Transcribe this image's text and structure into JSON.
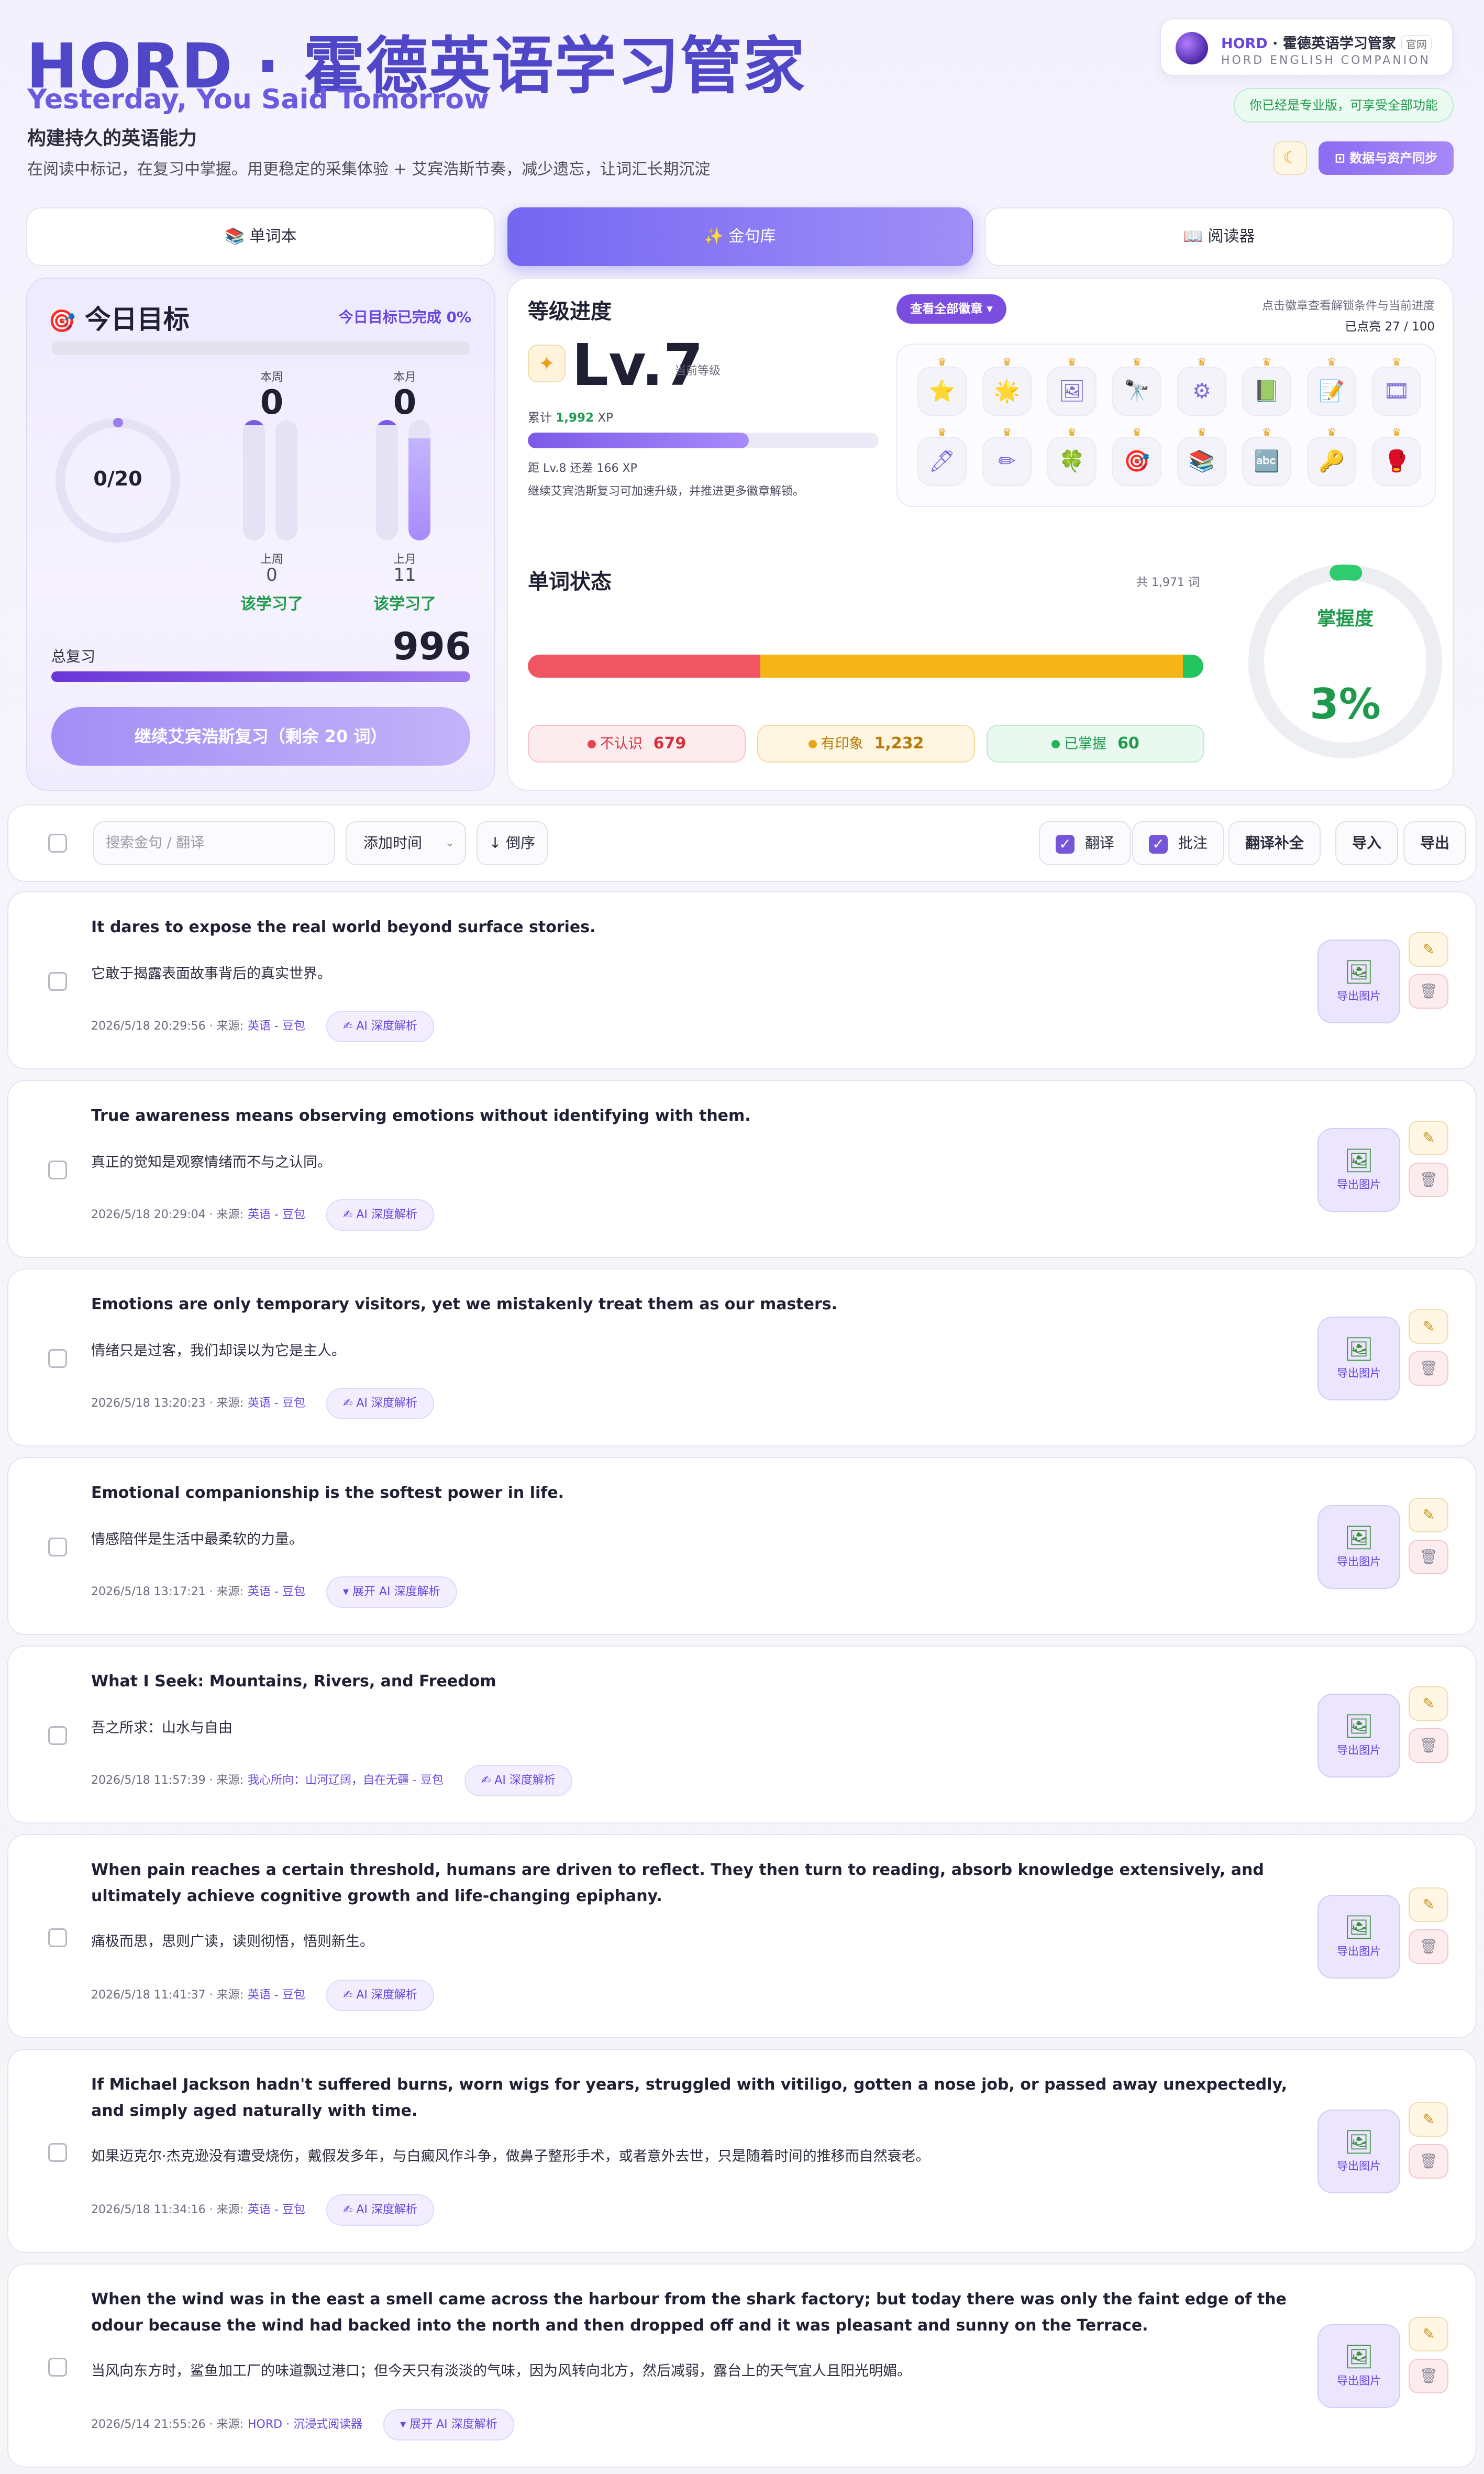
{
  "header": {
    "title": "HORD · 霍德英语学习管家",
    "subtitle": "Yesterday, You Said Tomorrow",
    "tagline": "构建持久的英语能力",
    "description": "在阅读中标记，在复习中掌握。用更稳定的采集体验 + 艾宾浩斯节奏，减少遗忘，让词汇长期沉淀"
  },
  "site": {
    "brand": "HORD",
    "name": " · 霍德英语学习管家",
    "official": "官网",
    "english": "HORD ENGLISH COMPANION"
  },
  "pro_badge": "你已经是专业版，可享受全部功能",
  "theme_icon": "moon-icon",
  "sync_button": "数据与资产同步",
  "tabs": [
    {
      "icon": "📚",
      "label": "单词本"
    },
    {
      "icon": "✨",
      "label": "金句库"
    },
    {
      "icon": "📖",
      "label": "阅读器"
    }
  ],
  "goal": {
    "title": "今日目标",
    "done_text": "今日目标已完成 0%",
    "progress_pct": 0,
    "ring_text": "0/20",
    "ring_fraction": 0,
    "week": {
      "label": "本周",
      "value": "0",
      "prev_label": "上周",
      "prev_value": "0",
      "prev_fraction": 0,
      "status": "该学习了"
    },
    "month": {
      "label": "本月",
      "value": "0",
      "prev_label": "上月",
      "prev_value": "11",
      "prev_fraction": 0.85,
      "status": "该学习了"
    },
    "total_label": "总复习",
    "total_value": "996",
    "review_button": "继续艾宾浩斯复习（剩余 20 词）"
  },
  "level": {
    "title": "等级进度",
    "badges_button": "查看全部徽章 ▾",
    "hint": "点击徽章查看解锁条件与当前进度",
    "lit_count": "已点亮 27 / 100",
    "star": "✦",
    "level": "Lv.7",
    "level_caption": "当前等级",
    "xp_prefix": "累计 ",
    "xp_value": "1,992",
    "xp_suffix": " XP",
    "xp_progress": 0.63,
    "next_text": "距 Lv.8 还差 166 XP",
    "tip": "继续艾宾浩斯复习可加速升级，并推进更多徽章解锁。",
    "badges": [
      "⭐",
      "🌟",
      "🖼",
      "🔭",
      "⚙",
      "📗",
      "📝",
      "🎞",
      "🖊",
      "✏",
      "🍀",
      "🎯",
      "📚",
      "🔤",
      "🔑",
      "🥊"
    ]
  },
  "words": {
    "title": "单词状态",
    "total_text": "共 1,971 词",
    "unknown": {
      "label": "不认识",
      "value": 679,
      "color": "#f05562"
    },
    "impression": {
      "label": "有印象",
      "value": 1232,
      "value_text": "1,232",
      "color": "#f5b418"
    },
    "mastered": {
      "label": "已掌握",
      "value": 60,
      "color": "#22c55e"
    },
    "mastery_label": "掌握度",
    "mastery_value": "3%",
    "mastery_fraction": 0.03
  },
  "toolbar": {
    "search_placeholder": "搜索金句 / 翻译",
    "sort_select": "添加时间",
    "order": "↓ 倒序",
    "translation_toggle": "翻译",
    "annotation_toggle": "批注",
    "fill_translation": "翻译补全",
    "import": "导入",
    "export": "导出"
  },
  "item_actions": {
    "export_image": "导出图片",
    "export_icon": "image-icon",
    "edit_icon": "pencil-icon",
    "delete_icon": "trash-icon"
  },
  "items": [
    {
      "en": "It dares to expose the real world beyond surface stories.",
      "zh": "它敢于揭露表面故事背后的真实世界。",
      "time": "2026/5/18 20:29:56 · 来源:",
      "source": "英语 - 豆包",
      "ai": "✍ AI 深度解析"
    },
    {
      "en": "True awareness means observing emotions without identifying with them.",
      "zh": "真正的觉知是观察情绪而不与之认同。",
      "time": "2026/5/18 20:29:04 · 来源:",
      "source": "英语 - 豆包",
      "ai": "✍ AI 深度解析"
    },
    {
      "en": "Emotions are only temporary visitors, yet we mistakenly treat them as our masters.",
      "zh": "情绪只是过客，我们却误以为它是主人。",
      "time": "2026/5/18 13:20:23 · 来源:",
      "source": "英语 - 豆包",
      "ai": "✍ AI 深度解析"
    },
    {
      "en": "Emotional companionship is the softest power in life.",
      "zh": "情感陪伴是生活中最柔软的力量。",
      "time": "2026/5/18 13:17:21 · 来源:",
      "source": "英语 - 豆包",
      "ai": "▾ 展开 AI 深度解析"
    },
    {
      "en": "What I Seek: Mountains, Rivers, and Freedom",
      "zh": "吾之所求：山水与自由",
      "time": "2026/5/18 11:57:39 · 来源:",
      "source": "我心所向：山河辽阔，自在无疆 - 豆包",
      "ai": "✍ AI 深度解析"
    },
    {
      "en": "When pain reaches a certain threshold, humans are driven to reflect. They then turn to reading, absorb knowledge extensively, and ultimately achieve cognitive growth and life-changing epiphany.",
      "zh": "痛极而思，思则广读，读则彻悟，悟则新生。",
      "time": "2026/5/18 11:41:37 · 来源:",
      "source": "英语 - 豆包",
      "ai": "✍ AI 深度解析"
    },
    {
      "en": "If Michael Jackson hadn't suffered burns, worn wigs for years, struggled with vitiligo, gotten a nose job, or passed away unexpectedly, and simply aged naturally with time.",
      "zh": "如果迈克尔·杰克逊没有遭受烧伤，戴假发多年，与白癜风作斗争，做鼻子整形手术，或者意外去世，只是随着时间的推移而自然衰老。",
      "time": "2026/5/18 11:34:16 · 来源:",
      "source": "英语 - 豆包",
      "ai": "✍ AI 深度解析"
    },
    {
      "en": "When the wind was in the east a smell came across the harbour from the shark factory; but today there was only the faint edge of the odour because the wind had backed into the north and then dropped off and it was pleasant and sunny on the Terrace.",
      "zh": "当风向东方时，鲨鱼加工厂的味道飘过港口；但今天只有淡淡的气味，因为风转向北方，然后减弱，露台上的天气宜人且阳光明媚。",
      "time": "2026/5/14 21:55:26 · 来源:",
      "source": "HORD · 沉浸式阅读器",
      "ai": "▾ 展开 AI 深度解析"
    }
  ]
}
